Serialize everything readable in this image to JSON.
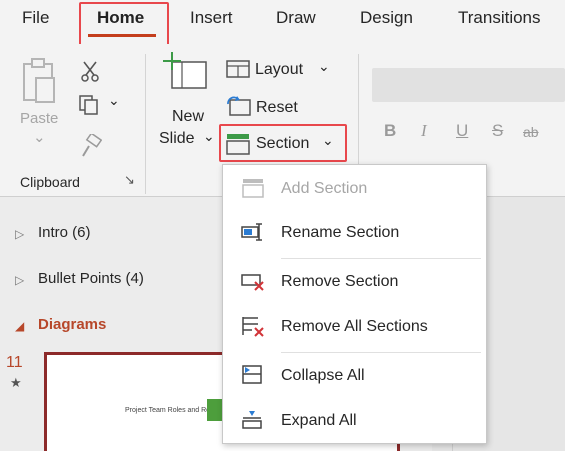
{
  "tabs": [
    {
      "label": "File",
      "active": false
    },
    {
      "label": "Home",
      "active": true
    },
    {
      "label": "Insert",
      "active": false
    },
    {
      "label": "Draw",
      "active": false
    },
    {
      "label": "Design",
      "active": false
    },
    {
      "label": "Transitions",
      "active": false
    }
  ],
  "clipboard": {
    "paste_label": "Paste",
    "paste_arrow": "⌄",
    "group_label": "Clipboard",
    "launcher_glyph": "↘"
  },
  "slides": {
    "new_slide_line1": "New",
    "new_slide_line2": "Slide",
    "layout_label": "Layout",
    "reset_label": "Reset",
    "section_label": "Section",
    "chevron": "⌄"
  },
  "font_format": [
    "B",
    "I",
    "U",
    "S",
    "ab"
  ],
  "section_menu": [
    {
      "label": "Add Section",
      "icon": "add-section-icon",
      "enabled": false
    },
    {
      "label": "Rename Section",
      "icon": "rename-section-icon",
      "enabled": true
    },
    {
      "label": "Remove Section",
      "icon": "remove-section-icon",
      "enabled": true
    },
    {
      "label": "Remove All Sections",
      "icon": "remove-all-sections-icon",
      "enabled": true
    },
    {
      "label": "Collapse All",
      "icon": "collapse-all-icon",
      "enabled": true
    },
    {
      "label": "Expand All",
      "icon": "expand-all-icon",
      "enabled": true
    }
  ],
  "slide_pane": {
    "sections": [
      {
        "label": "Intro (6)",
        "expanded": false
      },
      {
        "label": "Bullet Points (4)",
        "expanded": false
      },
      {
        "label": "Diagrams",
        "expanded": true
      }
    ],
    "slide_number": "11",
    "thumbnail_title": "Project Team Roles and Re"
  },
  "colors": {
    "accent": "#c43e1c",
    "highlight": "#e8474c",
    "section_active": "#b7472a",
    "remove_red": "#d13438"
  }
}
